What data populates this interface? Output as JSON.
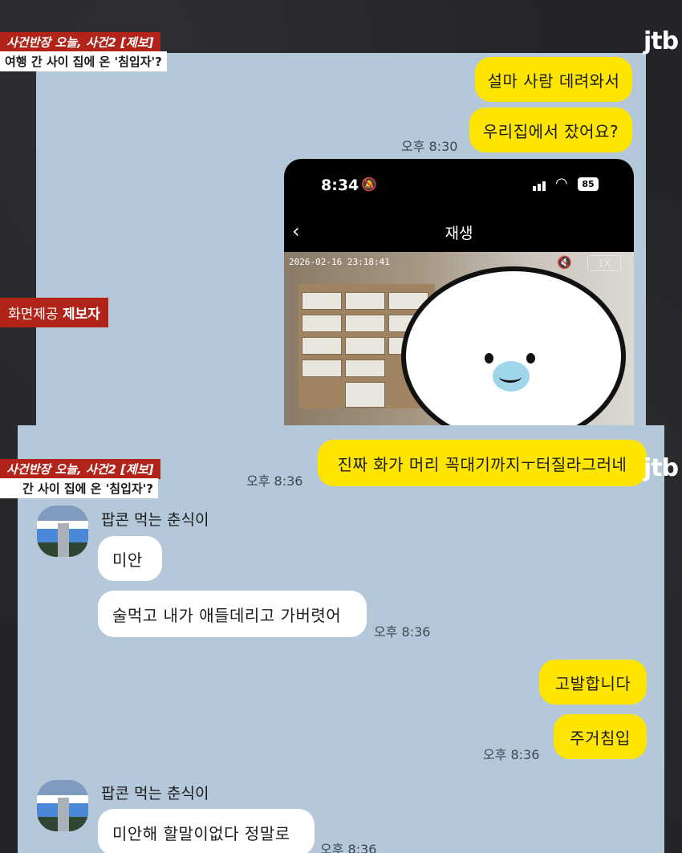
{
  "broadcast": {
    "program_tag": "사건반장 오늘, 사건2 [제보]",
    "headline": "여행 간 사이 집에 온 '침입자'?",
    "headline_partial": "간 사이 집에 온 '침입자'?",
    "credit_label": "화면제공",
    "credit_source": "제보자",
    "logo": "jtb"
  },
  "panel1": {
    "messages": [
      {
        "text": "설마 사람 데려와서",
        "side": "mine"
      },
      {
        "text": "우리집에서 잤어요?",
        "side": "mine"
      }
    ],
    "time": "오후 8:30",
    "phone": {
      "clock": "8:34",
      "battery": "85",
      "title": "재생",
      "timestamp": "2026-02-16 23:18:41",
      "speed": "1X"
    }
  },
  "panel2": {
    "top_message": {
      "text": "진짜 화가 머리 꼭대기까지ㅜ터질라그러네",
      "side": "mine"
    },
    "top_time": "오후 8:36",
    "groups": [
      {
        "sender": "팝콘 먹는 춘식이",
        "messages": [
          "미안",
          "술먹고 내가 애들데리고 가버렷어"
        ],
        "time": "오후 8:36"
      },
      {
        "sender": "팝콘 먹는 춘식이",
        "messages": [
          "미안해 할말이없다 정말로"
        ],
        "time": "오후 8:36"
      }
    ],
    "my_messages": [
      "고발합니다",
      "주거침입"
    ],
    "my_time": "오후 8:36"
  }
}
